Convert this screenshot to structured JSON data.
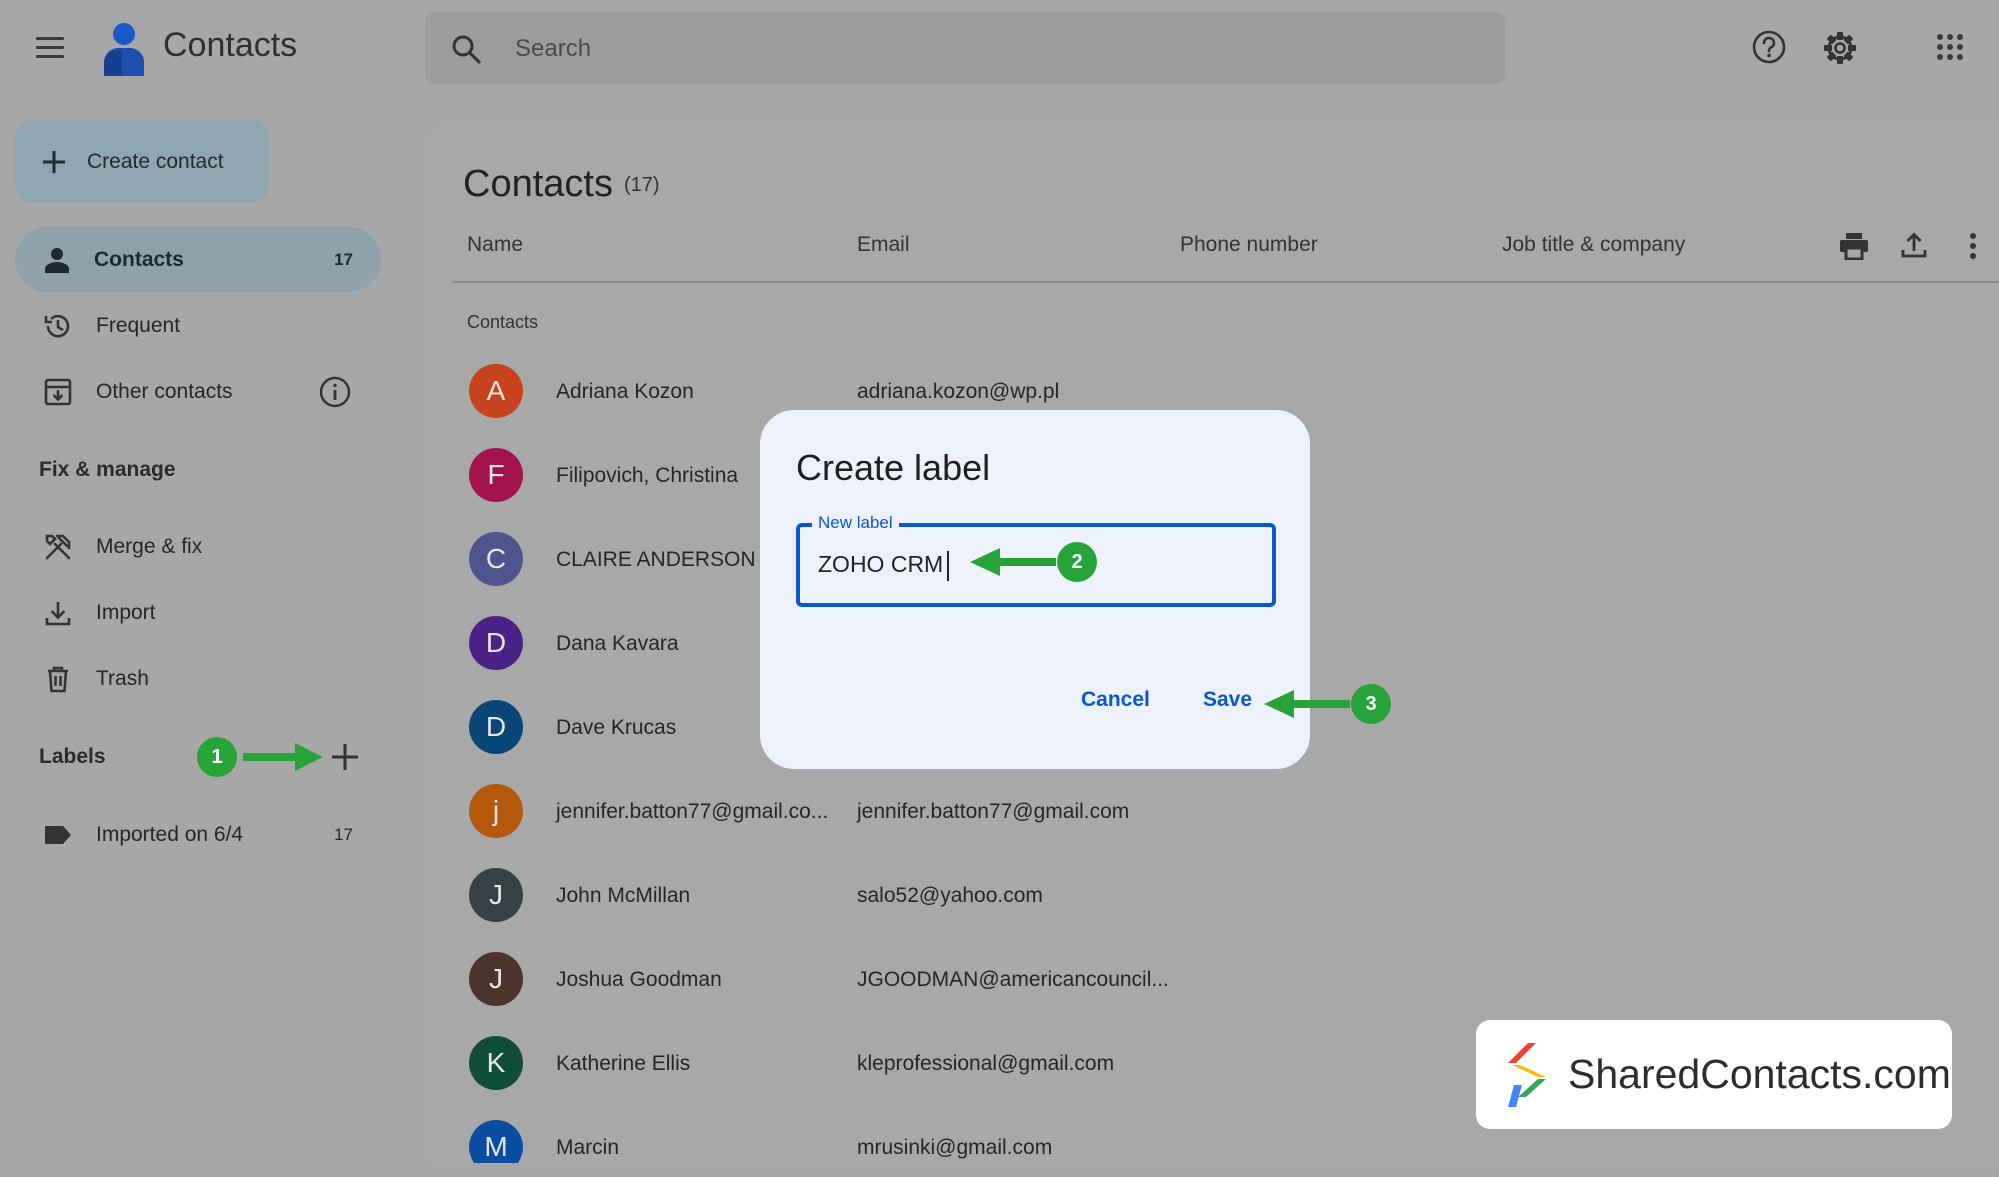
{
  "app": {
    "title": "Contacts"
  },
  "search": {
    "placeholder": "Search"
  },
  "sidebar": {
    "create_label": "Create contact",
    "items": [
      {
        "label": "Contacts",
        "count": "17",
        "icon": "person-icon"
      },
      {
        "label": "Frequent",
        "icon": "history-icon"
      },
      {
        "label": "Other contacts",
        "icon": "archive-download-icon"
      }
    ],
    "fix_manage": {
      "title": "Fix & manage",
      "items": [
        {
          "label": "Merge & fix",
          "icon": "tools-icon"
        },
        {
          "label": "Import",
          "icon": "download-icon"
        },
        {
          "label": "Trash",
          "icon": "trash-icon"
        }
      ]
    },
    "labels": {
      "title": "Labels",
      "items": [
        {
          "label": "Imported on 6/4",
          "count": "17",
          "icon": "label-icon"
        }
      ]
    }
  },
  "main": {
    "title": "Contacts",
    "count": "(17)",
    "columns": [
      "Name",
      "Email",
      "Phone number",
      "Job title & company"
    ],
    "group_label": "Contacts",
    "contacts": [
      {
        "initial": "A",
        "name": "Adriana Kozon",
        "email": "adriana.kozon@wp.pl",
        "color": "#c5431d"
      },
      {
        "initial": "F",
        "name": "Filipovich, Christina",
        "email": "",
        "color": "#a3144e"
      },
      {
        "initial": "C",
        "name": "CLAIRE ANDERSON",
        "email": "",
        "color": "#4e548c"
      },
      {
        "initial": "D",
        "name": "Dana Kavara",
        "email": "",
        "color": "#4b2386"
      },
      {
        "initial": "D",
        "name": "Dave Krucas",
        "email": "",
        "color": "#0a4578"
      },
      {
        "initial": "j",
        "name": "jennifer.batton77@gmail.co...",
        "email": "jennifer.batton77@gmail.com",
        "color": "#b4580c"
      },
      {
        "initial": "J",
        "name": "John McMillan",
        "email": "salo52@yahoo.com",
        "color": "#354145"
      },
      {
        "initial": "J",
        "name": "Joshua Goodman",
        "email": "JGOODMAN@americancouncil...",
        "color": "#4d342d"
      },
      {
        "initial": "K",
        "name": "Katherine Ellis",
        "email": "kleprofessional@gmail.com",
        "color": "#0f4d38"
      },
      {
        "initial": "M",
        "name": "Marcin",
        "email": "mrusinki@gmail.com",
        "color": "#0a4da1"
      }
    ]
  },
  "dialog": {
    "title": "Create label",
    "field_label": "New label",
    "field_value": "ZOHO CRM",
    "cancel_label": "Cancel",
    "save_label": "Save"
  },
  "annotations": {
    "step1": "1",
    "step2": "2",
    "step3": "3"
  },
  "brand": {
    "text": "SharedContacts.com"
  },
  "colors": {
    "accent": "#0b57d0",
    "annotation": "#27a33a",
    "active_nav": "#8ea1ad"
  }
}
